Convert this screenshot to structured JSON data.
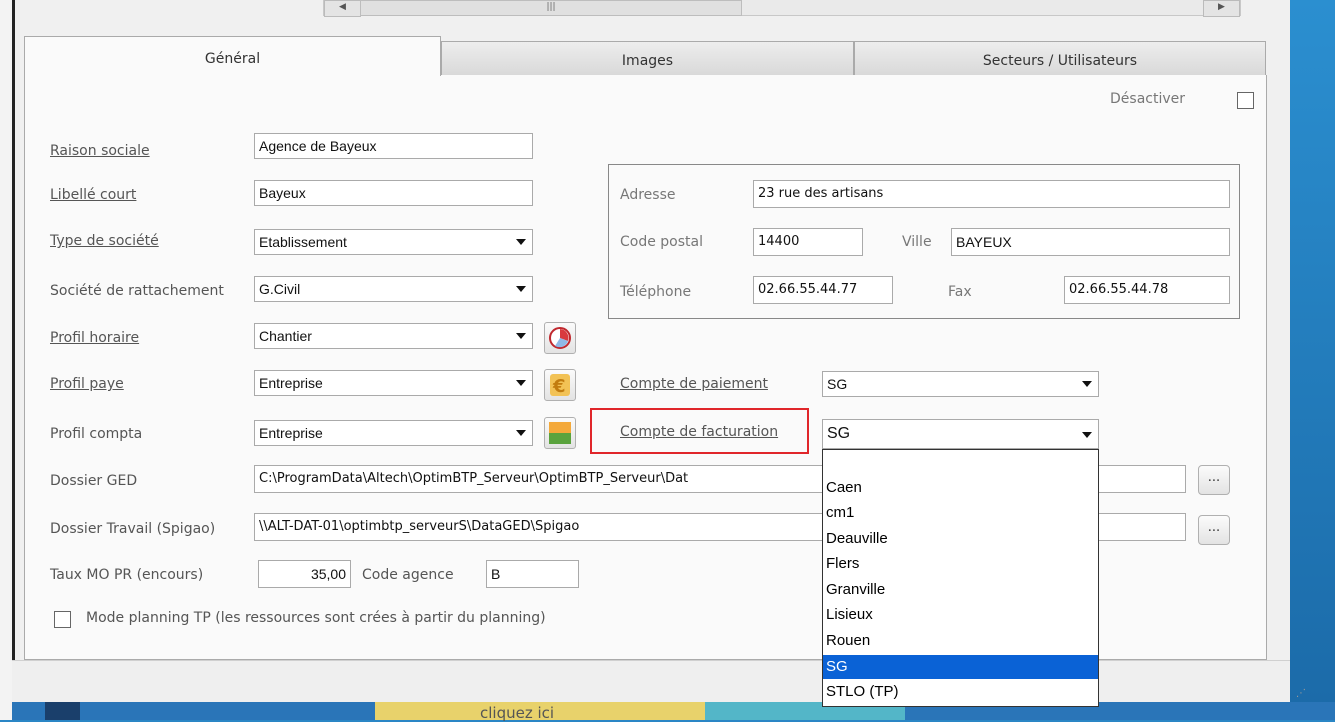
{
  "tabs": [
    "Général",
    "Images",
    "Secteurs / Utilisateurs"
  ],
  "desactiver_label": "Désactiver",
  "labels": {
    "raison_sociale": "Raison sociale",
    "libelle_court": "Libellé court",
    "type_societe": "Type de société",
    "societe_rattachement": "Société de rattachement",
    "profil_horaire": "Profil horaire",
    "profil_paye": "Profil paye",
    "profil_compta": "Profil compta",
    "dossier_ged": "Dossier GED",
    "dossier_travail": "Dossier Travail (Spigao)",
    "taux_mo": "Taux MO PR (encours)",
    "code_agence": "Code agence",
    "adresse": "Adresse",
    "code_postal": "Code postal",
    "ville": "Ville",
    "telephone": "Téléphone",
    "fax": "Fax",
    "compte_paiement": "Compte de paiement",
    "compte_facturation": "Compte de facturation",
    "mode_planning": "Mode planning TP (les ressources sont crées à partir du planning)"
  },
  "values": {
    "raison_sociale": "Agence de Bayeux",
    "libelle_court": "Bayeux",
    "type_societe": "Etablissement",
    "societe_rattachement": "G.Civil",
    "profil_horaire": "Chantier",
    "profil_paye": "Entreprise",
    "profil_compta": "Entreprise",
    "dossier_ged": "C:\\ProgramData\\Altech\\OptimBTP_Serveur\\OptimBTP_Serveur\\Dat",
    "dossier_travail": "\\\\ALT-DAT-01\\optimbtp_serveurS\\DataGED\\Spigao",
    "taux_mo": "35,00",
    "code_agence": "B",
    "adresse": "23 rue des artisans",
    "code_postal": "14400",
    "ville": "BAYEUX",
    "telephone": "02.66.55.44.77",
    "fax": "02.66.55.44.78",
    "compte_paiement": "SG",
    "compte_facturation": "SG"
  },
  "dots_label": "...",
  "dropdown_options": [
    "",
    "Caen",
    "cm1",
    "Deauville",
    "Flers",
    "Granville",
    "Lisieux",
    "Rouen",
    "SG",
    "STLO (TP)"
  ],
  "dropdown_selected": "SG",
  "background_text": "cliquez ici",
  "icons": {
    "profil_horaire": "clock-chart-icon",
    "profil_paye": "euro-icon",
    "profil_compta": "ledger-icon"
  },
  "colors": {
    "highlight_border": "#e0262a",
    "selection": "#0a62d6"
  }
}
